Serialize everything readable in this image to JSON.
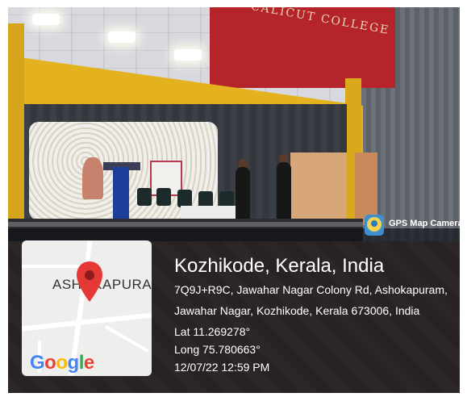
{
  "scene": {
    "wall_text": "CALICUT COLLEGE"
  },
  "badge": {
    "app_name": "GPS Map Camera",
    "icon": "gps-map-camera-icon"
  },
  "map": {
    "area_label": "ASHOKAPURA",
    "logo": [
      "G",
      "o",
      "o",
      "g",
      "l",
      "e"
    ],
    "logo_colors": [
      "#4285F4",
      "#EA4335",
      "#FBBC05",
      "#4285F4",
      "#34A853",
      "#EA4335"
    ],
    "pin_icon": "map-pin-icon",
    "pin_color": "#E53935"
  },
  "location": {
    "title": "Kozhikode, Kerala, India",
    "address_line1": "7Q9J+R9C, Jawahar Nagar Colony Rd, Ashokapuram,",
    "address_line2": "Jawahar Nagar, Kozhikode, Kerala 673006, India",
    "lat": "Lat 11.269278°",
    "long": "Long 75.780663°",
    "datetime": "12/07/22 12:59 PM"
  }
}
